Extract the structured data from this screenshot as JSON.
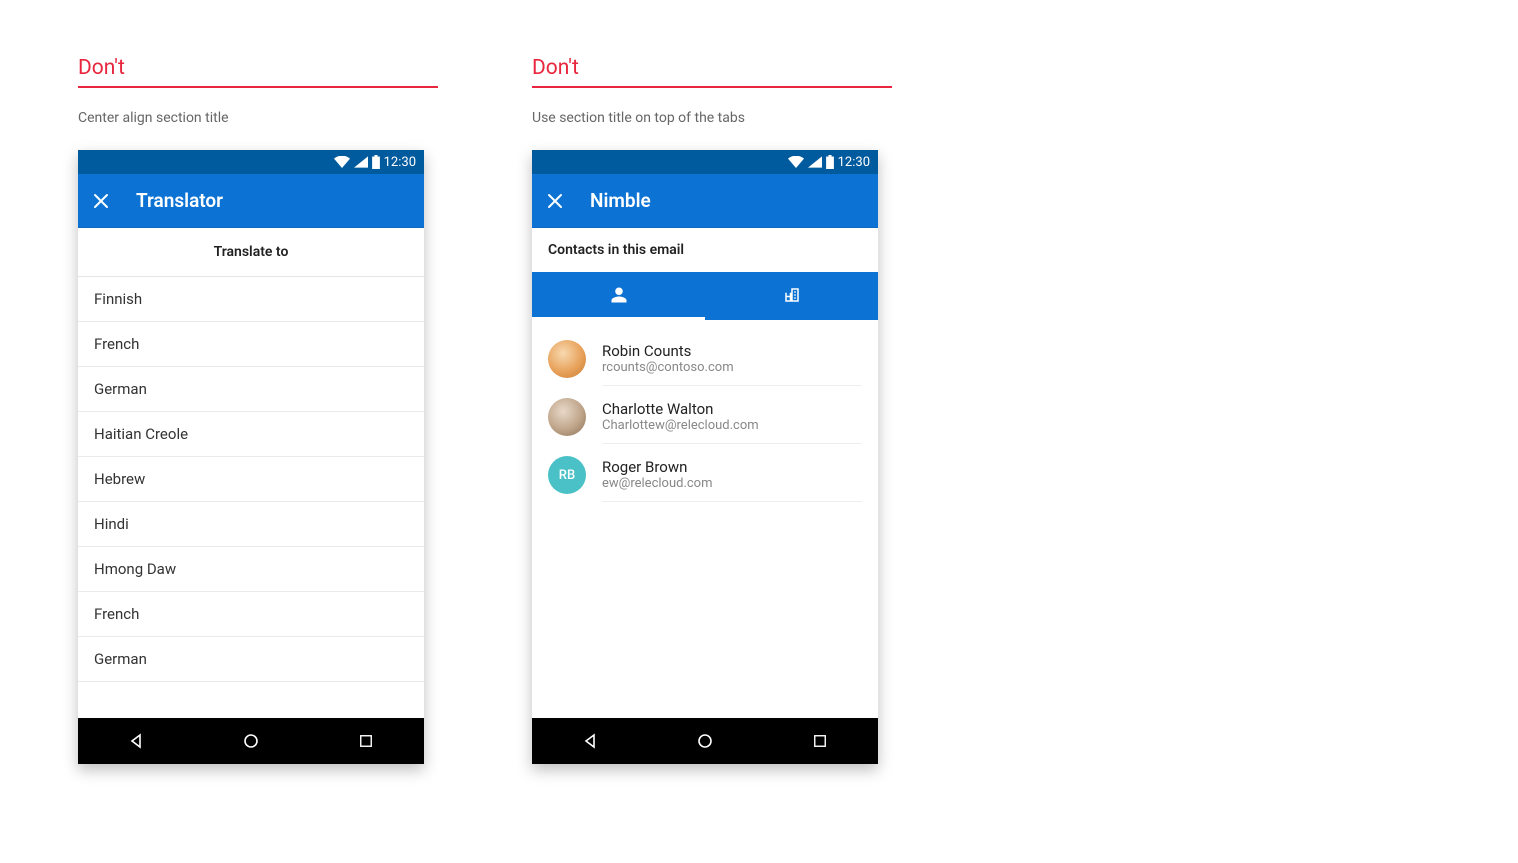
{
  "examples": [
    {
      "label": "Don't",
      "caption": "Center align section title",
      "status_time": "12:30",
      "app_title": "Translator",
      "section_title": "Translate to",
      "languages": [
        "Finnish",
        "French",
        "German",
        "Haitian Creole",
        "Hebrew",
        "Hindi",
        "Hmong Daw",
        "French",
        "German"
      ]
    },
    {
      "label": "Don't",
      "caption": "Use section title on top of the tabs",
      "status_time": "12:30",
      "app_title": "Nimble",
      "section_title": "Contacts in this email",
      "contacts": [
        {
          "name": "Robin Counts",
          "email": "rcounts@contoso.com",
          "initials": ""
        },
        {
          "name": "Charlotte Walton",
          "email": "Charlottew@relecloud.com",
          "initials": ""
        },
        {
          "name": "Roger Brown",
          "email": "ew@relecloud.com",
          "initials": "RB"
        }
      ]
    }
  ],
  "colors": {
    "accent": "#e8263d",
    "brand": "#0c73d4",
    "brand_dark": "#005a9e"
  }
}
